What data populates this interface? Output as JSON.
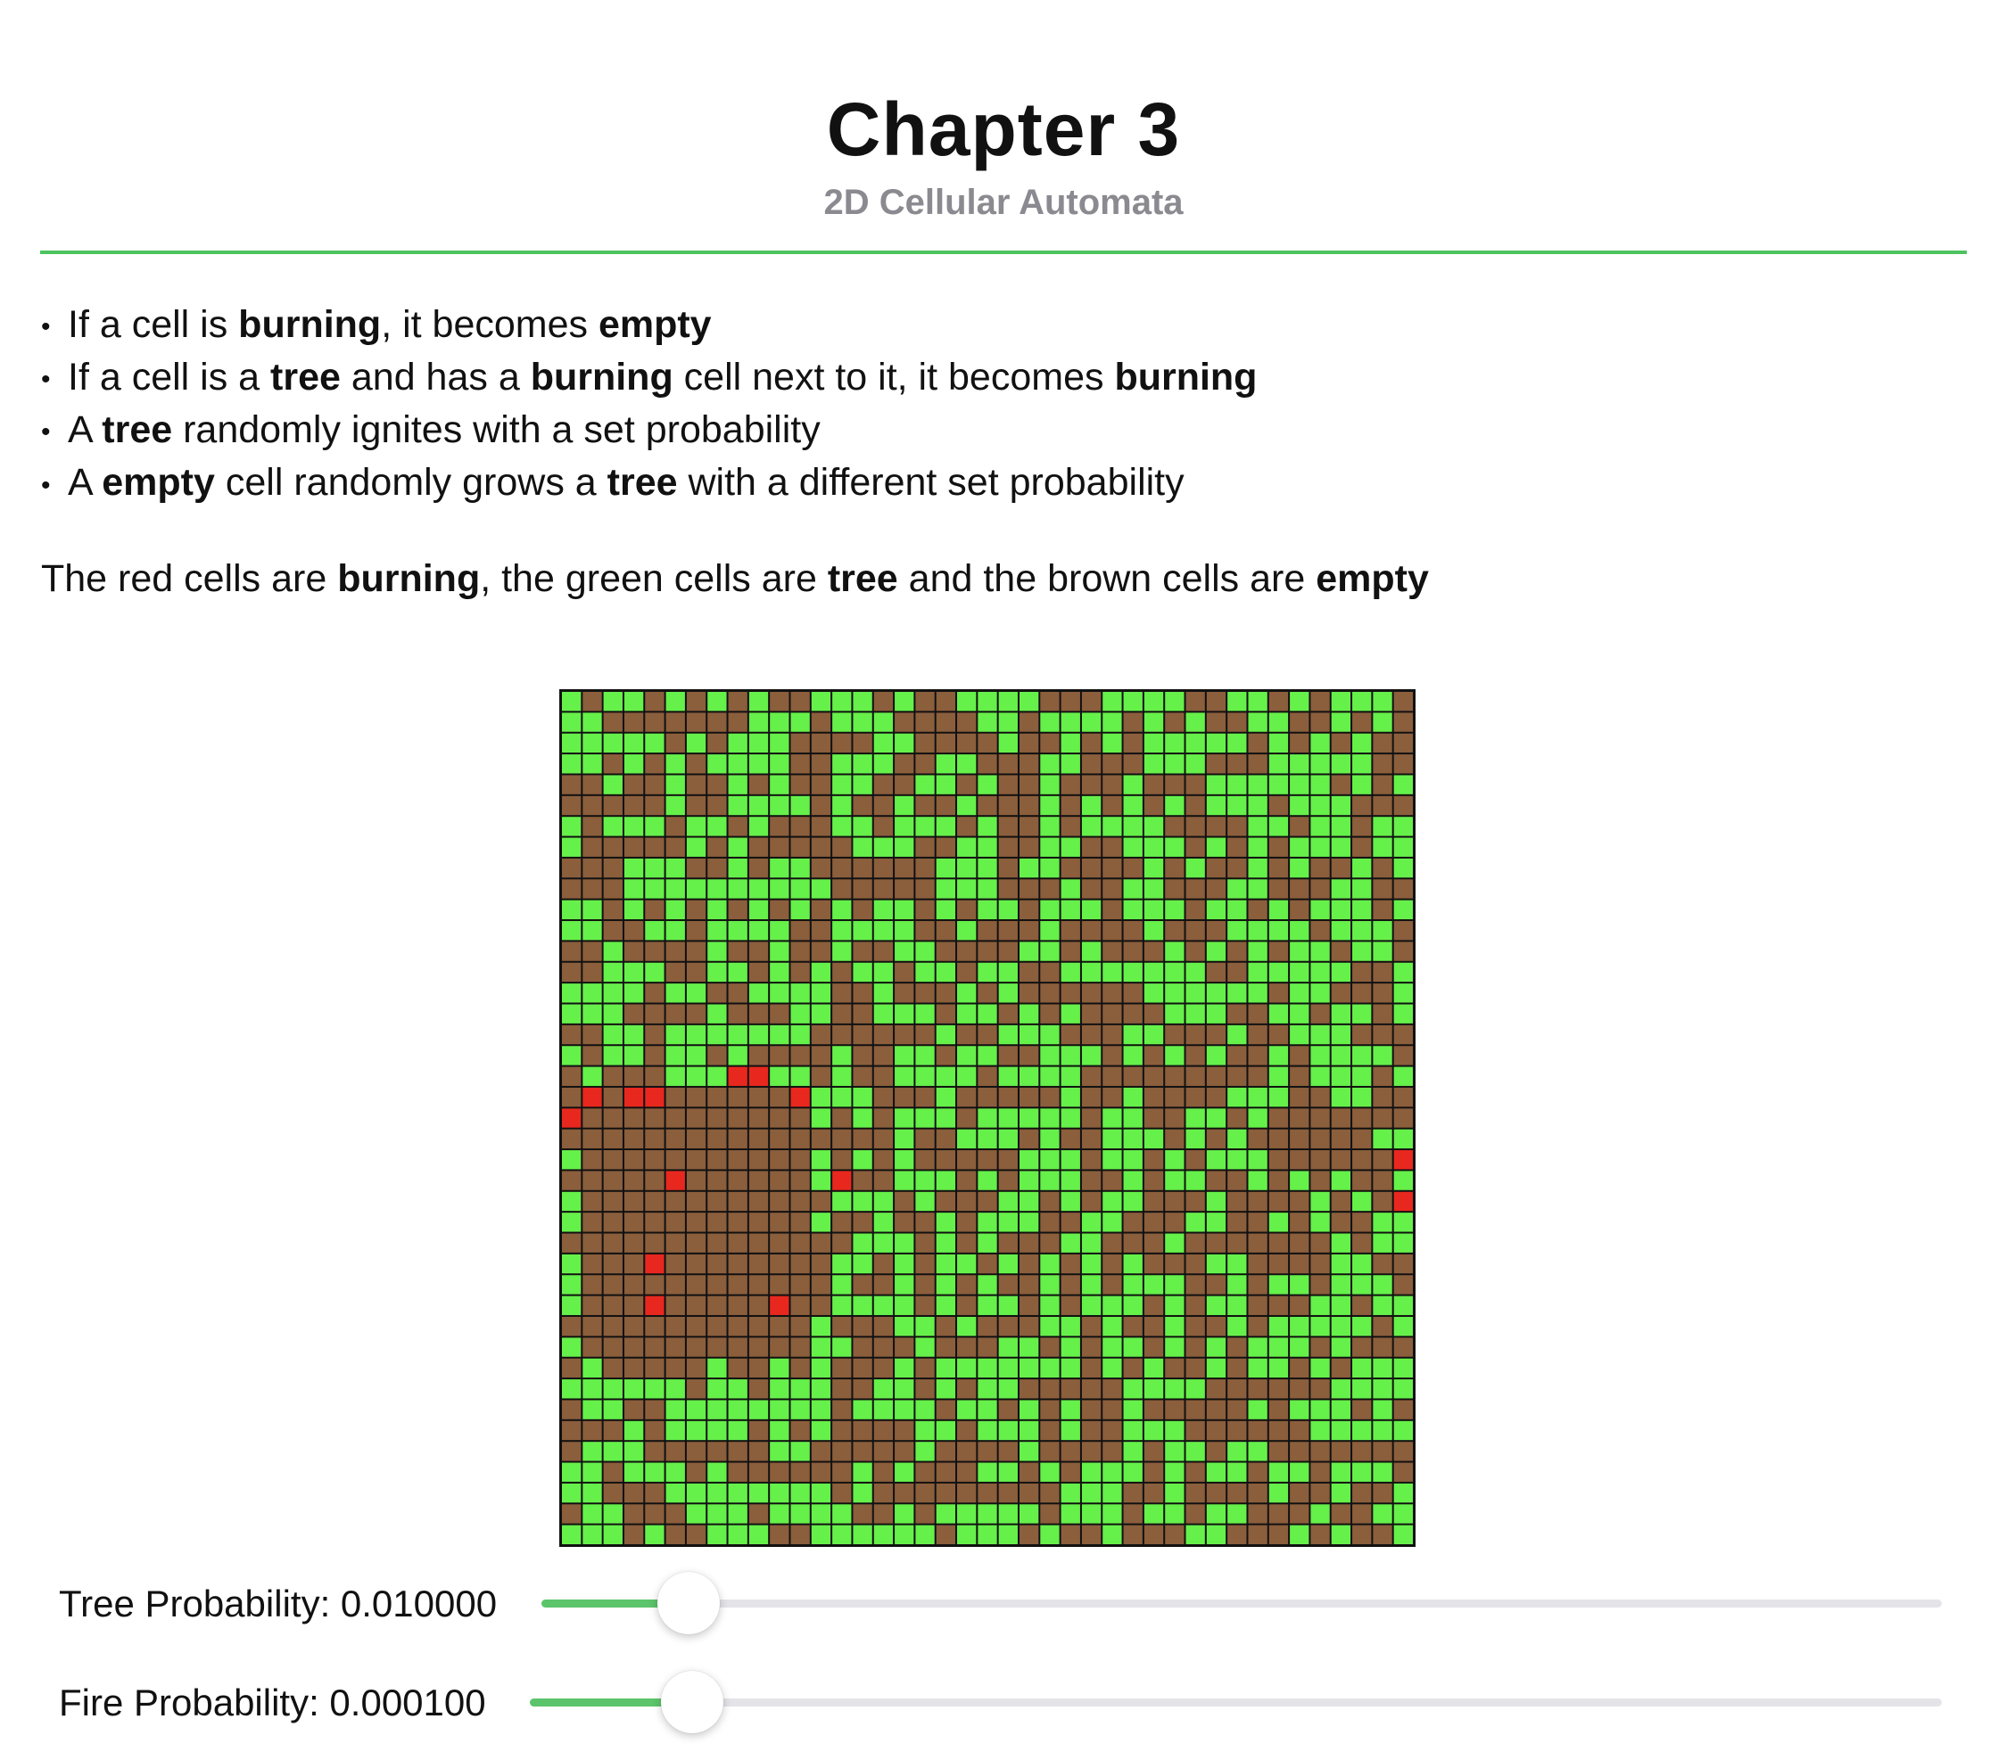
{
  "header": {
    "title": "Chapter 3",
    "subtitle": "2D Cellular Automata"
  },
  "rules": [
    [
      {
        "t": "If a cell is "
      },
      {
        "t": "burning",
        "b": true
      },
      {
        "t": ", it becomes "
      },
      {
        "t": "empty",
        "b": true
      }
    ],
    [
      {
        "t": "If a cell is a "
      },
      {
        "t": "tree",
        "b": true
      },
      {
        "t": " and has a "
      },
      {
        "t": "burning",
        "b": true
      },
      {
        "t": " cell next to it, it becomes "
      },
      {
        "t": "burning",
        "b": true
      }
    ],
    [
      {
        "t": "A "
      },
      {
        "t": "tree",
        "b": true
      },
      {
        "t": " randomly ignites with a set probability"
      }
    ],
    [
      {
        "t": "A "
      },
      {
        "t": "empty",
        "b": true
      },
      {
        "t": " cell randomly grows a "
      },
      {
        "t": "tree",
        "b": true
      },
      {
        "t": " with a different set probability"
      }
    ]
  ],
  "legend": [
    {
      "t": "The red cells are "
    },
    {
      "t": "burning",
      "b": true
    },
    {
      "t": ", the green cells are "
    },
    {
      "t": "tree",
      "b": true
    },
    {
      "t": " and the brown cells are "
    },
    {
      "t": "empty",
      "b": true
    }
  ],
  "colors": {
    "burning": "#e8281e",
    "tree": "#66f04a",
    "empty": "#8b5e3c",
    "accent": "#4cc35e"
  },
  "grid": {
    "cols": 41,
    "rows": 41,
    "tree_density": 0.5,
    "burning_cells": [
      [
        19,
        1
      ],
      [
        19,
        3
      ],
      [
        19,
        4
      ],
      [
        18,
        8
      ],
      [
        18,
        9
      ],
      [
        19,
        11
      ],
      [
        20,
        0
      ],
      [
        23,
        5
      ],
      [
        23,
        13
      ],
      [
        22,
        40
      ],
      [
        24,
        40
      ],
      [
        27,
        4
      ],
      [
        29,
        4
      ],
      [
        29,
        10
      ]
    ],
    "ash_region": {
      "r0": 19,
      "r1": 31,
      "c0": 1,
      "c1": 11
    }
  },
  "controls": {
    "tree_probability": {
      "label": "Tree Probability: 0.010000",
      "value": 0.01,
      "fraction": 0.105
    },
    "fire_probability": {
      "label": "Fire Probability: 0.000100",
      "value": 0.0001,
      "fraction": 0.115
    }
  }
}
